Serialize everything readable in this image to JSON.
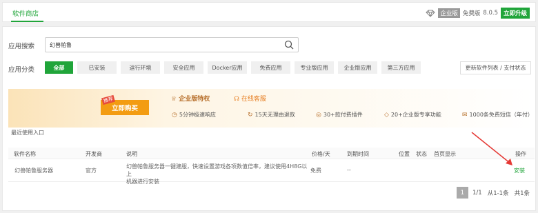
{
  "topbar": {
    "tab": "软件商店",
    "edition": "企业版",
    "free_label": "免费版",
    "version": "8.0.5",
    "upgrade": "立即升级"
  },
  "search": {
    "label": "应用搜索",
    "value": "幻兽帕鲁"
  },
  "categories": {
    "label": "应用分类",
    "items": [
      "全部",
      "已安装",
      "运行环境",
      "安全应用",
      "Docker应用",
      "免费应用",
      "专业版应用",
      "企业版应用",
      "第三方应用"
    ],
    "refresh": "更新软件列表 / 支付状态"
  },
  "banner": {
    "recommend": "推荐",
    "buy": "立即购买",
    "privilege": "企业版特权",
    "online_service": "在线客服",
    "perks": [
      "5分钟极速响应",
      "15天无理由退款",
      "30+款付费插件",
      "20+企业版专享功能",
      "1000条免费短信（年付）"
    ]
  },
  "recent_label": "最近使用入口",
  "table": {
    "headers": [
      "软件名称",
      "开发商",
      "说明",
      "价格/天",
      "到期时间",
      "位置",
      "状态",
      "首页显示",
      "操作"
    ],
    "rows": [
      {
        "name": "幻兽帕鲁服务器",
        "developer": "官方",
        "desc_line1": "幻兽帕鲁服务器一键建服，快速设置游戏各项数值倍率，建议使用4H8G以上",
        "desc_line2": "机器进行安装",
        "price": "免费",
        "expiry": "--",
        "action": "安装"
      }
    ]
  },
  "pager": {
    "current": "1",
    "pages": "1/1",
    "range": "从1-1条",
    "total": "共1条"
  },
  "colors": {
    "accent": "#20a53a",
    "arrow": "#e53935",
    "buy": "#f39c12"
  }
}
